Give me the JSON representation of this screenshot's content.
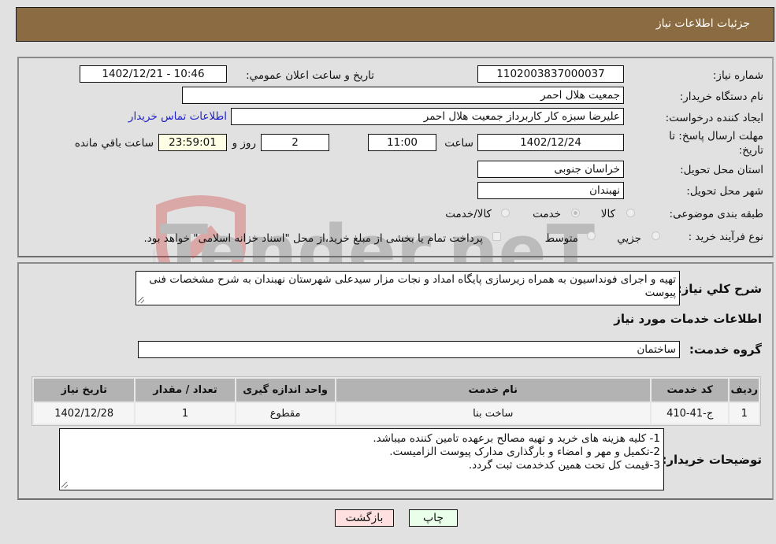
{
  "header": {
    "title": "جزئیات اطلاعات نیاز"
  },
  "form": {
    "need_number": {
      "label": "شماره نیاز:",
      "value": "1102003837000037"
    },
    "announce_datetime": {
      "label": "تاریخ و ساعت اعلان عمومي:",
      "value": "1402/12/21 - 10:46"
    },
    "buyer_org": {
      "label": "نام دستگاه خریدار:",
      "value": "جمعیت هلال احمر"
    },
    "requester": {
      "label": "ایجاد کننده درخواست:",
      "value": "علیرضا  سبزه کار کاربرداز جمعیت هلال احمر"
    },
    "buyer_contact_link": "اطلاعات تماس خریدار",
    "deadline": {
      "label_line1": "مهلت ارسال پاسخ: تا",
      "label_line2": "تاریخ:",
      "date": "1402/12/24",
      "time_label": "ساعت",
      "time": "11:00",
      "days": "2",
      "days_label": "روز و",
      "remaining": "23:59:01",
      "remaining_label": "ساعت باقي مانده"
    },
    "province": {
      "label": "استان محل تحویل:",
      "value": "خراسان جنوبی"
    },
    "city": {
      "label": "شهر محل تحویل:",
      "value": "نهبندان"
    },
    "category": {
      "label": "طبقه بندی موضوعی:",
      "options": [
        "کالا",
        "خدمت",
        "کالا/خدمت"
      ],
      "selected": "خدمت"
    },
    "purchase_type": {
      "label": "نوع فرآیند خرید :",
      "options": [
        "جزيي",
        "متوسط"
      ],
      "selected": "متوسط",
      "treasury_note": "پرداخت تمام یا بخشی از مبلغ خرید،از محل \"اسناد خزانه اسلامی\" خواهد بود."
    }
  },
  "description": {
    "label": "شرح کلي نیاز:",
    "value": "تهیه و اجرای فونداسیون به همراه زیرسازی پایگاه امداد و نجات مزار سیدعلی شهرستان نهبندان به شرح مشخصات فنی پیوست"
  },
  "services_section": {
    "title": "اطلاعات خدمات مورد نیاز",
    "group_label": "گروه خدمت:",
    "group_value": "ساختمان",
    "table": {
      "headers": [
        "ردیف",
        "کد خدمت",
        "نام خدمت",
        "واحد اندازه گیری",
        "تعداد / مقدار",
        "تاریخ نیاز"
      ],
      "rows": [
        [
          "1",
          "ج-41-410",
          "ساخت بنا",
          "مقطوع",
          "1",
          "1402/12/28"
        ]
      ]
    }
  },
  "buyer_notes": {
    "label": "توضیحات خریدار:",
    "lines": [
      "1- کلیه هزینه های خرید و تهیه مصالح برعهده تامین کننده میباشد.",
      "2-تکمیل و مهر و امضاء و بارگذاری مدارک پیوست الزامیست.",
      "3-قیمت کل تحت همین کدخدمت ثبت گردد."
    ]
  },
  "buttons": {
    "print": "چاپ",
    "back": "بازگشت"
  },
  "watermark": "AriaTender.neT",
  "colors": {
    "header_bg": "#8b6b42",
    "link": "#2222cc",
    "back_btn": "#ffe0e0",
    "print_btn": "#eaffea",
    "remaining_bg": "#ffffe6"
  }
}
